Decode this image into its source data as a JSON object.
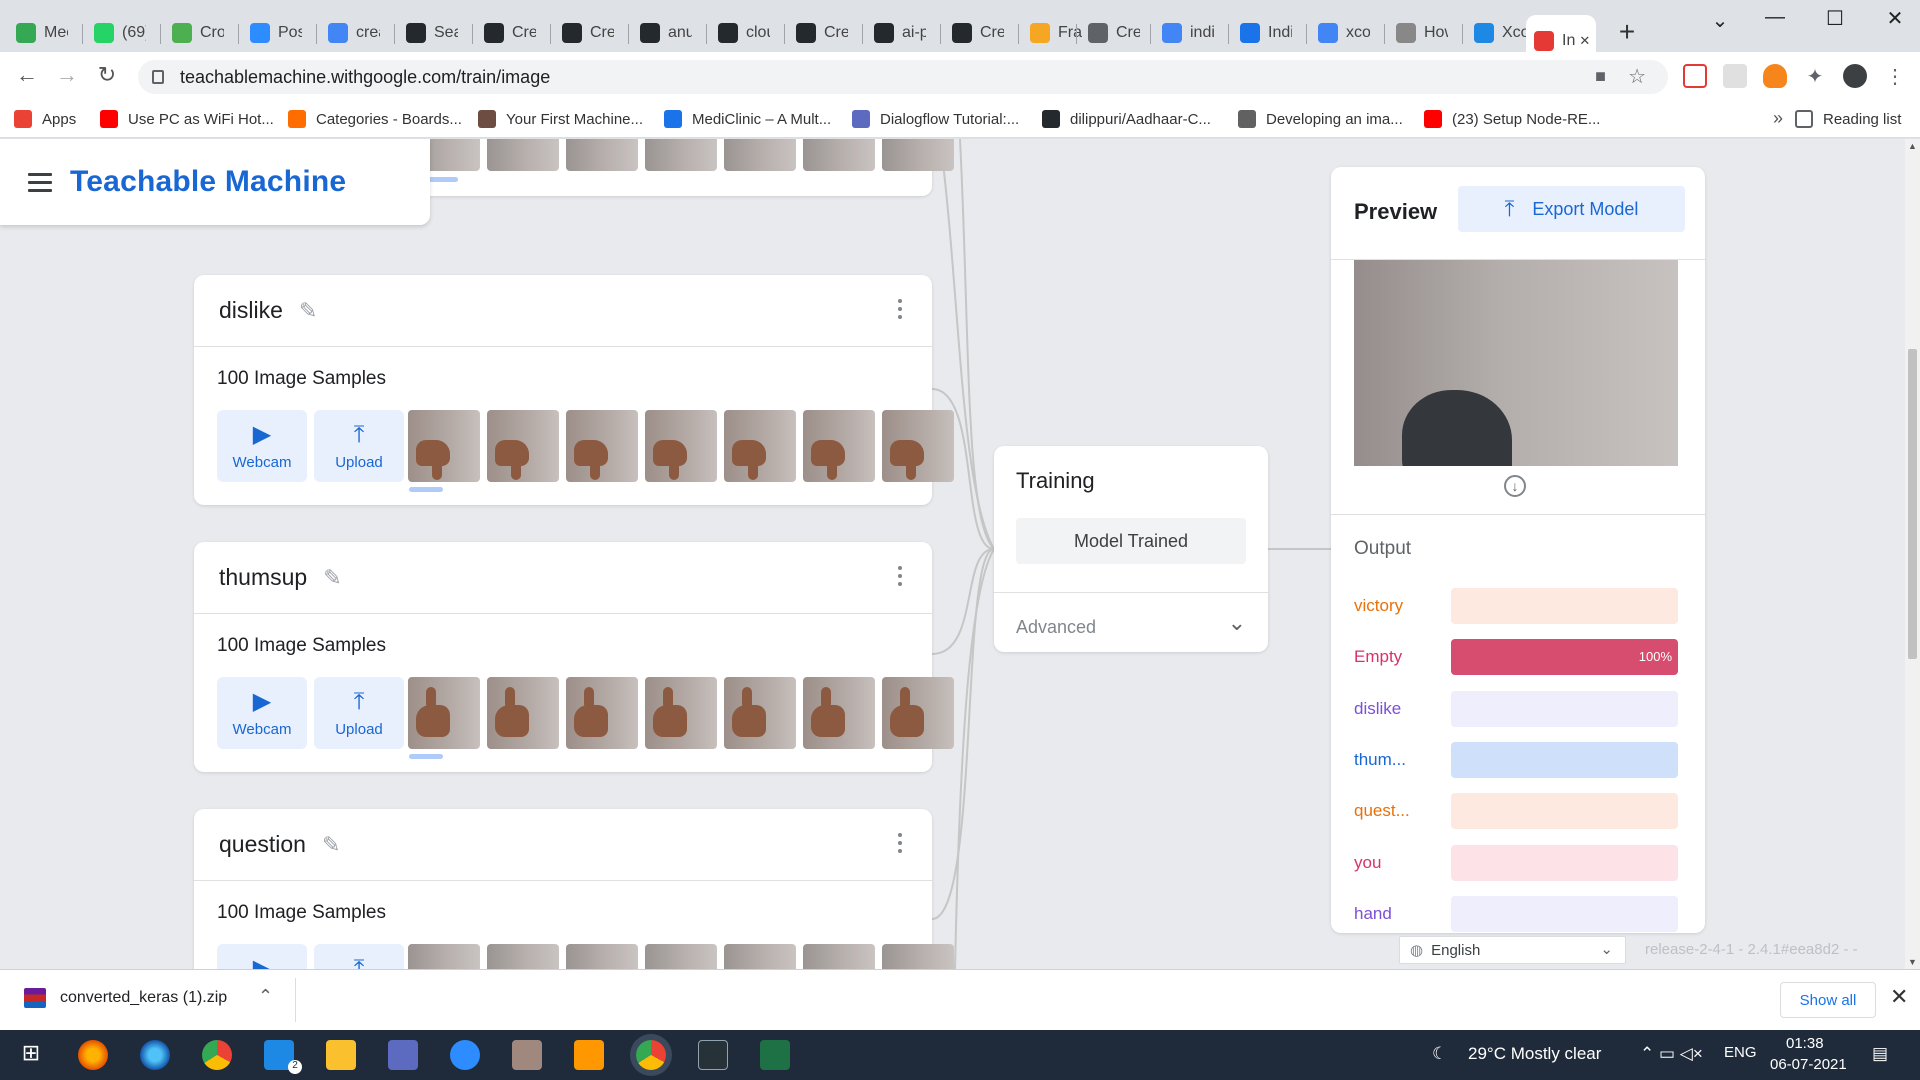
{
  "browser": {
    "tabs": [
      {
        "label": "Mee",
        "color": "#34a853"
      },
      {
        "label": "(69)",
        "color": "#25d366"
      },
      {
        "label": "Cro",
        "color": "#4caf50"
      },
      {
        "label": "Post",
        "color": "#2d8cff"
      },
      {
        "label": "crea",
        "color": "#4285f4"
      },
      {
        "label": "Sear",
        "color": "#24292e"
      },
      {
        "label": "Crea",
        "color": "#24292e"
      },
      {
        "label": "Crea",
        "color": "#24292e"
      },
      {
        "label": "anu",
        "color": "#24292e"
      },
      {
        "label": "clou",
        "color": "#24292e"
      },
      {
        "label": "Crea",
        "color": "#24292e"
      },
      {
        "label": "ai-p",
        "color": "#24292e"
      },
      {
        "label": "Crea",
        "color": "#24292e"
      },
      {
        "label": "Frau",
        "color": "#f5a623"
      },
      {
        "label": "Crea",
        "color": "#5f6368"
      },
      {
        "label": "indi",
        "color": "#4285f4"
      },
      {
        "label": "Indi",
        "color": "#1a73e8"
      },
      {
        "label": "xco",
        "color": "#4285f4"
      },
      {
        "label": "How",
        "color": "#888888"
      },
      {
        "label": "Xco",
        "color": "#1e88e5"
      },
      {
        "label": "In",
        "color": "#e53935",
        "active": true
      }
    ],
    "url": "teachablemachine.withgoogle.com/train/image",
    "bookmarks": [
      {
        "label": "Apps",
        "color": "#ea4335"
      },
      {
        "label": "Use PC as WiFi Hot...",
        "color": "#ff0000"
      },
      {
        "label": "Categories - Boards...",
        "color": "#ff6d00"
      },
      {
        "label": "Your First Machine...",
        "color": "#6d4c41"
      },
      {
        "label": "MediClinic – A Mult...",
        "color": "#1a73e8"
      },
      {
        "label": "Dialogflow Tutorial:...",
        "color": "#5c6bc0"
      },
      {
        "label": "dilippuri/Aadhaar-C...",
        "color": "#24292e"
      },
      {
        "label": "Developing an ima...",
        "color": "#616161"
      },
      {
        "label": "(23) Setup Node-RE...",
        "color": "#ff0000"
      }
    ],
    "more_bookmarks": "»",
    "reading_list": "Reading list"
  },
  "app": {
    "title": "Teachable Machine",
    "classes": [
      {
        "name": "dislike",
        "samples": "100 Image Samples",
        "webcam": "Webcam",
        "upload": "Upload",
        "thumb_kind": "down"
      },
      {
        "name": "thumsup",
        "samples": "100 Image Samples",
        "webcam": "Webcam",
        "upload": "Upload",
        "thumb_kind": "up"
      },
      {
        "name": "question",
        "samples": "100 Image Samples",
        "webcam": "Webcam",
        "upload": "Upload",
        "thumb_kind": "gray"
      }
    ],
    "training": {
      "title": "Training",
      "button": "Model Trained",
      "advanced": "Advanced"
    },
    "preview": {
      "title": "Preview",
      "export": "Export Model",
      "output_title": "Output",
      "outputs": [
        {
          "label": "victory",
          "color": "#e8710a",
          "bg": "#fde9df",
          "value": 0
        },
        {
          "label": "Empty",
          "color": "#d6336c",
          "bg": "#fde3e8",
          "value": 1.0,
          "pct": "100%",
          "fill": "#d64d6f"
        },
        {
          "label": "dislike",
          "color": "#7b4fd6",
          "bg": "#eeeefc",
          "value": 0
        },
        {
          "label": "thum...",
          "color": "#1967d2",
          "bg": "#cfe0fb",
          "value": 0
        },
        {
          "label": "quest...",
          "color": "#e8710a",
          "bg": "#fde9df",
          "value": 0
        },
        {
          "label": "you",
          "color": "#d6336c",
          "bg": "#fde3e8",
          "value": 0
        },
        {
          "label": "hand",
          "color": "#7b4fd6",
          "bg": "#eeeefc",
          "value": 0
        }
      ]
    },
    "language": "English",
    "release": "release-2-4-1 - 2.4.1#eea8d2 - -"
  },
  "downloads": {
    "file": "converted_keras (1).zip",
    "show_all": "Show all"
  },
  "taskbar": {
    "weather": "29°C  Mostly clear",
    "lang": "ENG",
    "time": "01:38",
    "date": "06-07-2021",
    "badge": "2"
  }
}
